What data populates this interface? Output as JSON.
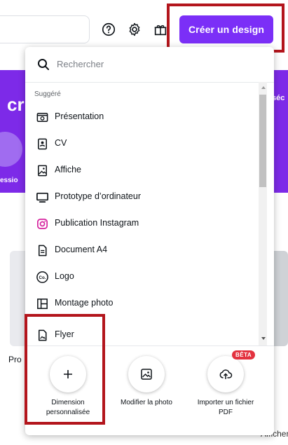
{
  "header": {
    "create_label": "Créer un design",
    "icons": [
      "help-icon",
      "settings-icon",
      "gift-icon"
    ]
  },
  "background": {
    "hero_text": "cr",
    "hero_sub": "essio",
    "hero_right": "séc",
    "card_label": "Pro",
    "footer_label": "Afficher"
  },
  "dropdown": {
    "search_placeholder": "Rechercher",
    "section_label": "Suggéré",
    "items": [
      {
        "label": "Présentation",
        "icon": "presentation-icon"
      },
      {
        "label": "CV",
        "icon": "resume-icon"
      },
      {
        "label": "Affiche",
        "icon": "poster-icon"
      },
      {
        "label": "Prototype d’ordinateur",
        "icon": "desktop-icon"
      },
      {
        "label": "Publication Instagram",
        "icon": "instagram-icon"
      },
      {
        "label": "Document A4",
        "icon": "document-icon"
      },
      {
        "label": "Logo",
        "icon": "logo-icon"
      },
      {
        "label": "Montage photo",
        "icon": "collage-icon"
      },
      {
        "label": "Flyer",
        "icon": "flyer-icon"
      }
    ],
    "quick_actions": [
      {
        "label": "Dimension personnalisée",
        "icon": "plus-icon"
      },
      {
        "label": "Modifier la photo",
        "icon": "edit-photo-icon"
      },
      {
        "label": "Importer un fichier PDF",
        "icon": "cloud-upload-icon",
        "badge": "BÊTA"
      }
    ]
  },
  "colors": {
    "brand": "#7b2ff7",
    "highlight": "#b3151c",
    "badge": "#e3323f"
  }
}
